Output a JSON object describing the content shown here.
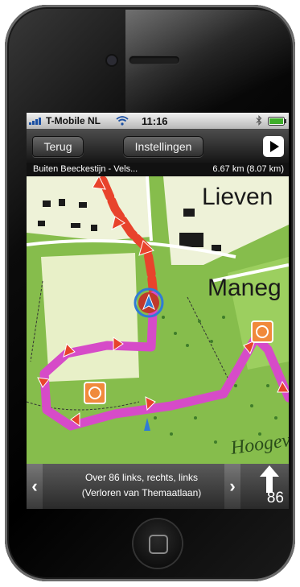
{
  "status": {
    "carrier": "T-Mobile NL",
    "time": "11:16"
  },
  "nav": {
    "back_label": "Terug",
    "settings_label": "Instellingen"
  },
  "route": {
    "name": "Buiten Beeckestijn - Vels...",
    "distance": "6.67 km (8.07 km)"
  },
  "map": {
    "labels": [
      "Lieven",
      "Maneg",
      "Hoogeve"
    ]
  },
  "instruction": {
    "line1": "Over  86 links, rechts, links",
    "line2": "(Verloren van Themaatlaan)",
    "distance": "86"
  },
  "colors": {
    "route_walked": "#e8432c",
    "route_planned": "#d64bc8",
    "position": "#2f7bd6",
    "waypoint": "#f08a3c"
  },
  "icons": [
    "wifi-icon",
    "signal-icon",
    "battery-icon",
    "bluetooth-icon",
    "play-icon",
    "chevron-left-icon",
    "chevron-right-icon",
    "arrow-up-icon",
    "location-icon",
    "waypoint-icon"
  ]
}
